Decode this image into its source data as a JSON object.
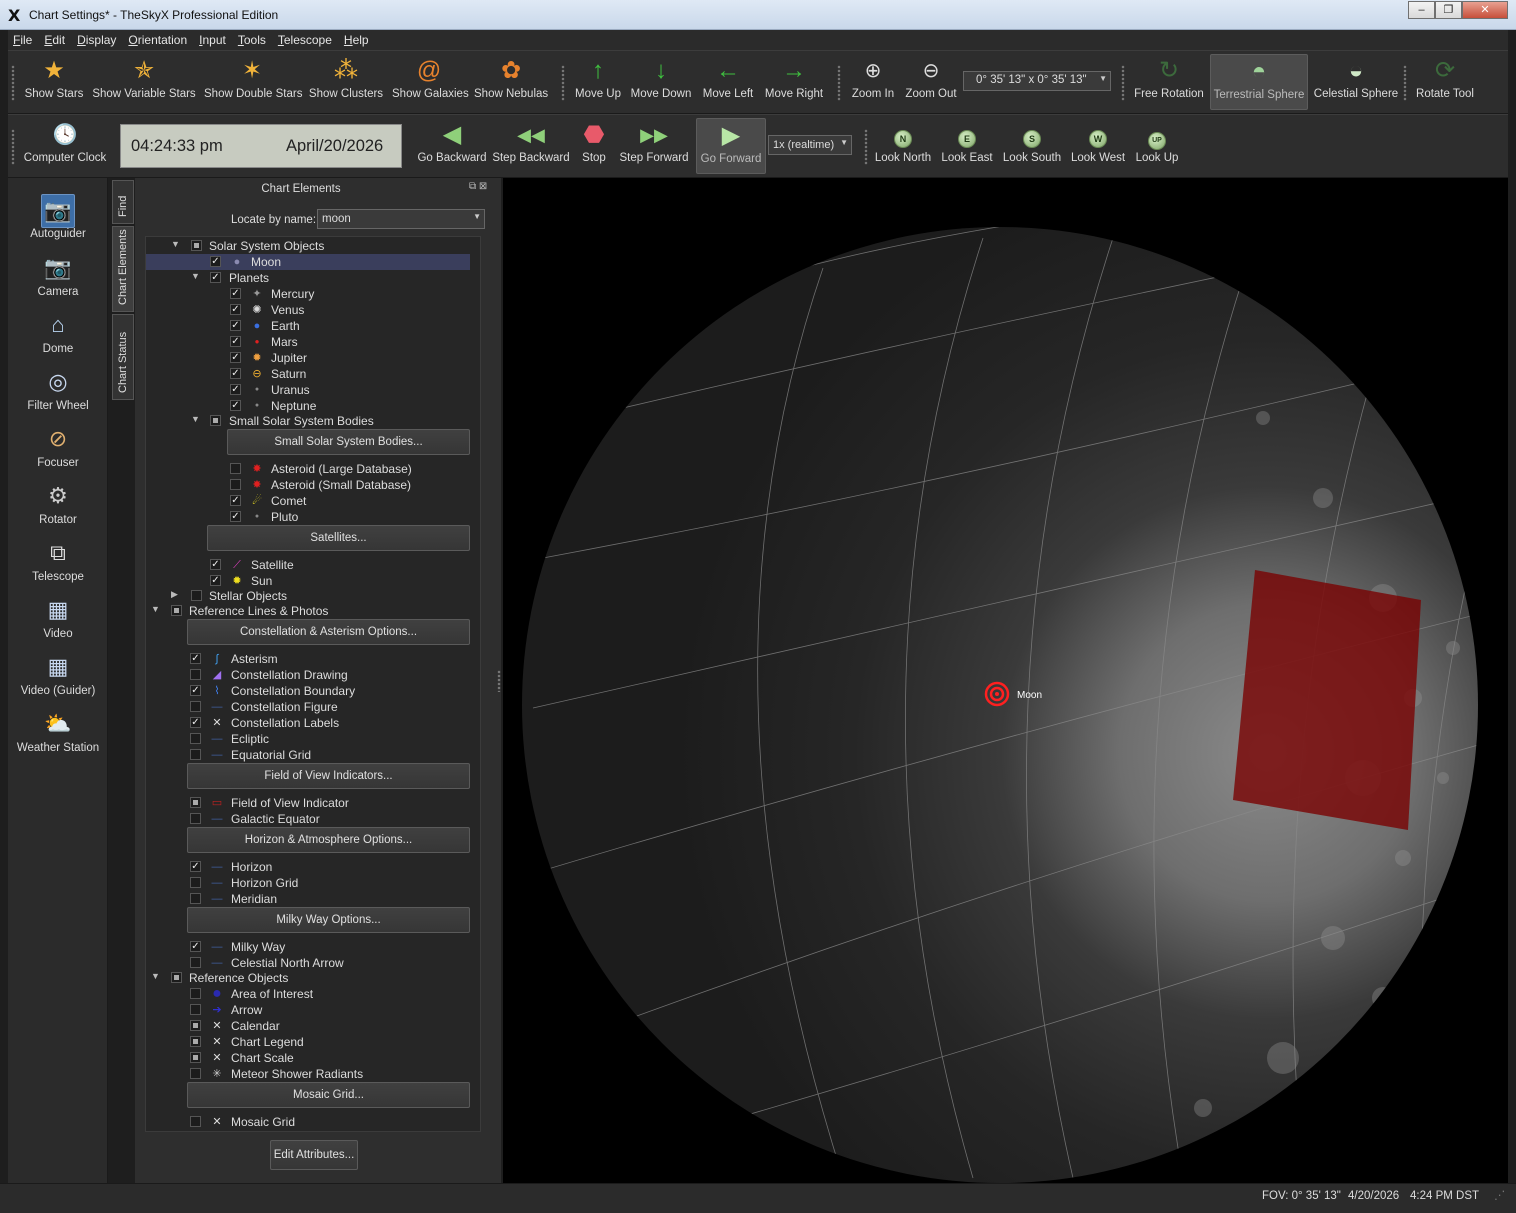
{
  "window": {
    "title": "Chart Settings* - TheSkyX Professional Edition"
  },
  "menu": [
    "File",
    "Edit",
    "Display",
    "Orientation",
    "Input",
    "Tools",
    "Telescope",
    "Help"
  ],
  "toolbar1": {
    "show_stars": "Show Stars",
    "show_variable_stars": "Show Variable Stars",
    "show_double_stars": "Show Double Stars",
    "show_clusters": "Show Clusters",
    "show_galaxies": "Show Galaxies",
    "show_nebulas": "Show Nebulas",
    "move_up": "Move Up",
    "move_down": "Move Down",
    "move_left": "Move Left",
    "move_right": "Move Right",
    "zoom_in": "Zoom In",
    "zoom_out": "Zoom Out",
    "fov_value": "0° 35' 13\" x 0° 35' 13\"",
    "free_rotation": "Free Rotation",
    "terrestrial_sphere": "Terrestrial Sphere",
    "celestial_sphere": "Celestial Sphere",
    "rotate_tool": "Rotate Tool"
  },
  "toolbar2": {
    "computer_clock": "Computer Clock",
    "time": "04:24:33 pm",
    "date": "April/20/2026",
    "go_backward": "Go Backward",
    "step_backward": "Step Backward",
    "stop": "Stop",
    "step_forward": "Step Forward",
    "go_forward": "Go Forward",
    "rate": "1x (realtime)",
    "look_north": "Look North",
    "look_east": "Look East",
    "look_south": "Look South",
    "look_west": "Look West",
    "look_up": "Look Up",
    "look_n_glyph": "N",
    "look_e_glyph": "E",
    "look_s_glyph": "S",
    "look_w_glyph": "W",
    "look_up_glyph": "UP"
  },
  "dock": {
    "autoguider": "Autoguider",
    "camera": "Camera",
    "dome": "Dome",
    "filter_wheel": "Filter Wheel",
    "focuser": "Focuser",
    "rotator": "Rotator",
    "telescope": "Telescope",
    "video": "Video",
    "video_guider": "Video (Guider)",
    "weather_station": "Weather Station"
  },
  "vtabs": {
    "find": "Find",
    "chart_elements": "Chart Elements",
    "chart_status": "Chart Status"
  },
  "panel": {
    "title": "Chart Elements",
    "locate_label": "Locate by name:",
    "locate_value": "moon",
    "edit_attributes": "Edit Attributes..."
  },
  "tree": {
    "solar_system_objects": "Solar System Objects",
    "moon": "Moon",
    "planets": "Planets",
    "mercury": "Mercury",
    "venus": "Venus",
    "earth": "Earth",
    "mars": "Mars",
    "jupiter": "Jupiter",
    "saturn": "Saturn",
    "uranus": "Uranus",
    "neptune": "Neptune",
    "small_bodies": "Small Solar System Bodies",
    "small_bodies_btn": "Small Solar System Bodies...",
    "asteroid_large": "Asteroid (Large Database)",
    "asteroid_small": "Asteroid (Small Database)",
    "comet": "Comet",
    "pluto": "Pluto",
    "satellites_btn": "Satellites...",
    "satellite": "Satellite",
    "sun": "Sun",
    "stellar_objects": "Stellar Objects",
    "ref_lines": "Reference Lines & Photos",
    "constellation_btn": "Constellation & Asterism Options...",
    "asterism": "Asterism",
    "const_drawing": "Constellation Drawing",
    "const_boundary": "Constellation Boundary",
    "const_figure": "Constellation Figure",
    "const_labels": "Constellation Labels",
    "ecliptic": "Ecliptic",
    "equatorial_grid": "Equatorial Grid",
    "fov_btn": "Field of View Indicators...",
    "fov_indicator": "Field of View Indicator",
    "galactic_equator": "Galactic Equator",
    "horizon_btn": "Horizon & Atmosphere Options...",
    "horizon": "Horizon",
    "horizon_grid": "Horizon Grid",
    "meridian": "Meridian",
    "milky_btn": "Milky Way Options...",
    "milky_way": "Milky Way",
    "celestial_north_arrow": "Celestial North Arrow",
    "reference_objects": "Reference Objects",
    "area_of_interest": "Area of Interest",
    "arrow": "Arrow",
    "calendar": "Calendar",
    "chart_legend": "Chart Legend",
    "chart_scale": "Chart Scale",
    "meteor_shower": "Meteor Shower Radiants",
    "mosaic_btn": "Mosaic Grid...",
    "mosaic_grid": "Mosaic Grid"
  },
  "chart": {
    "target_label": "Moon"
  },
  "status": {
    "fov": "FOV: 0° 35' 13\"",
    "date": "4/20/2026",
    "time": "4:24 PM DST"
  },
  "colors": {
    "accent": "#3d6ea7",
    "fov_box": "#8b0000",
    "target": "#ff2020"
  }
}
